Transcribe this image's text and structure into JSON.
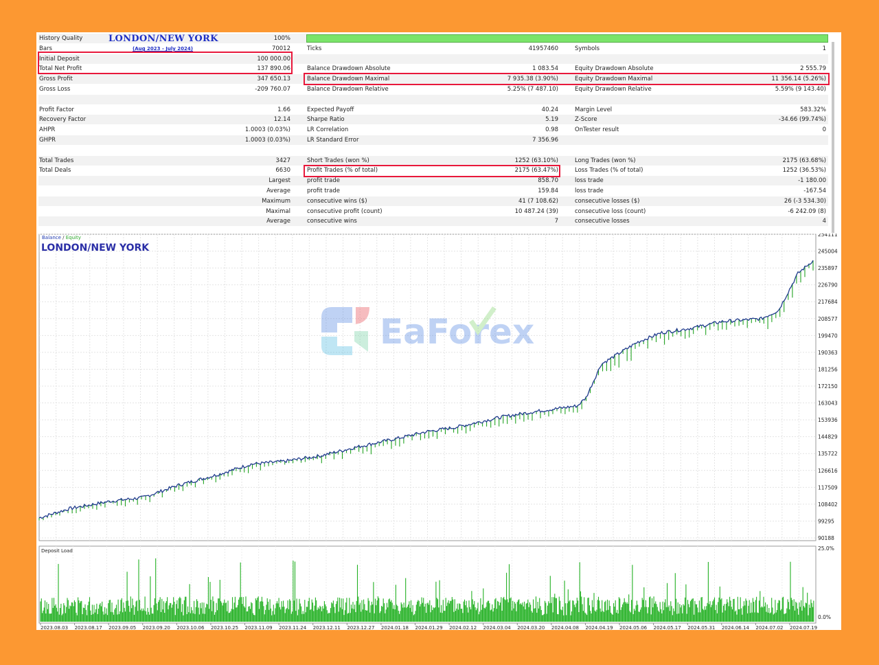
{
  "report": {
    "title": "LONDON/NEW YORK",
    "subtitle": "(Aug 2023 - July 2024)",
    "rows": [
      {
        "alt": true,
        "c1l": "History Quality",
        "c1v": "100%",
        "c2l": "",
        "c2v": "",
        "c3l": "",
        "c3v": ""
      },
      {
        "alt": false,
        "c1l": "Bars",
        "c1v": "70012",
        "c2l": "Ticks",
        "c2v": "41957460",
        "c3l": "Symbols",
        "c3v": "1"
      },
      {
        "alt": true,
        "c1l": "Initial Deposit",
        "c1v": "100 000.00",
        "c2l": "",
        "c2v": "",
        "c3l": "",
        "c3v": ""
      },
      {
        "alt": false,
        "c1l": "Total Net Profit",
        "c1v": "137 890.06",
        "c2l": "Balance Drawdown Absolute",
        "c2v": "1 083.54",
        "c3l": "Equity Drawdown Absolute",
        "c3v": "2 555.79"
      },
      {
        "alt": true,
        "c1l": "Gross Profit",
        "c1v": "347 650.13",
        "c2l": "Balance Drawdown Maximal",
        "c2v": "7 935.38 (3.90%)",
        "c3l": "Equity Drawdown Maximal",
        "c3v": "11 356.14 (5.26%)"
      },
      {
        "alt": false,
        "c1l": "Gross Loss",
        "c1v": "-209 760.07",
        "c2l": "Balance Drawdown Relative",
        "c2v": "5.25% (7 487.10)",
        "c3l": "Equity Drawdown Relative",
        "c3v": "5.59% (9 143.40)"
      },
      {
        "alt": true,
        "c1l": "",
        "c1v": "",
        "c2l": "",
        "c2v": "",
        "c3l": "",
        "c3v": ""
      },
      {
        "alt": false,
        "c1l": "Profit Factor",
        "c1v": "1.66",
        "c2l": "Expected Payoff",
        "c2v": "40.24",
        "c3l": "Margin Level",
        "c3v": "583.32%"
      },
      {
        "alt": true,
        "c1l": "Recovery Factor",
        "c1v": "12.14",
        "c2l": "Sharpe Ratio",
        "c2v": "5.19",
        "c3l": "Z-Score",
        "c3v": "-34.66 (99.74%)"
      },
      {
        "alt": false,
        "c1l": "AHPR",
        "c1v": "1.0003 (0.03%)",
        "c2l": "LR Correlation",
        "c2v": "0.98",
        "c3l": "OnTester result",
        "c3v": "0"
      },
      {
        "alt": true,
        "c1l": "GHPR",
        "c1v": "1.0003 (0.03%)",
        "c2l": "LR Standard Error",
        "c2v": "7 356.96",
        "c3l": "",
        "c3v": ""
      },
      {
        "alt": false,
        "c1l": "",
        "c1v": "",
        "c2l": "",
        "c2v": "",
        "c3l": "",
        "c3v": ""
      },
      {
        "alt": true,
        "c1l": "Total Trades",
        "c1v": "3427",
        "c2l": "Short Trades (won %)",
        "c2v": "1252 (63.10%)",
        "c3l": "Long Trades (won %)",
        "c3v": "2175 (63.68%)"
      },
      {
        "alt": false,
        "c1l": "Total Deals",
        "c1v": "6630",
        "c2l": "Profit Trades (% of total)",
        "c2v": "2175 (63.47%)",
        "c3l": "Loss Trades (% of total)",
        "c3v": "1252 (36.53%)"
      },
      {
        "alt": true,
        "c1l": "",
        "c1v": "Largest",
        "c2l": "profit trade",
        "c2v": "858.70",
        "c3l": "loss trade",
        "c3v": "-1 180.00"
      },
      {
        "alt": false,
        "c1l": "",
        "c1v": "Average",
        "c2l": "profit trade",
        "c2v": "159.84",
        "c3l": "loss trade",
        "c3v": "-167.54"
      },
      {
        "alt": true,
        "c1l": "",
        "c1v": "Maximum",
        "c2l": "consecutive wins ($)",
        "c2v": "41 (7 108.62)",
        "c3l": "consecutive losses ($)",
        "c3v": "26 (-3 534.30)"
      },
      {
        "alt": false,
        "c1l": "",
        "c1v": "Maximal",
        "c2l": "consecutive profit (count)",
        "c2v": "10 487.24 (39)",
        "c3l": "consecutive loss (count)",
        "c3v": "-6 242.09 (8)"
      },
      {
        "alt": true,
        "c1l": "",
        "c1v": "Average",
        "c2l": "consecutive wins",
        "c2v": "7",
        "c3l": "consecutive losses",
        "c3v": "4"
      }
    ]
  },
  "colors": {
    "background": "#fc9832",
    "highlight": "#e8173a",
    "balance": "#1f3a8c",
    "equity": "#1fa81f",
    "deposit_load": "#22b022",
    "title_blue": "#2b2fa7"
  },
  "chart_data": [
    {
      "type": "line",
      "title": "LONDON/NEW YORK",
      "legend": [
        "Balance",
        "Equity"
      ],
      "legend_separator": "/",
      "y_ticks": [
        "254111",
        "245004",
        "235897",
        "226790",
        "217684",
        "208577",
        "199470",
        "190363",
        "181256",
        "172150",
        "163043",
        "153936",
        "144829",
        "135722",
        "126616",
        "117509",
        "108402",
        "99295",
        "90188"
      ],
      "ylim": [
        90188,
        254111
      ],
      "x_start": "2023.08.03",
      "x_end": "2024.07.26",
      "series": [
        {
          "name": "Balance",
          "x": [
            "2023.08.03",
            "2023.08.17",
            "2023.09.05",
            "2023.09.20",
            "2023.10.06",
            "2023.10.25",
            "2023.11.09",
            "2023.11.24",
            "2023.12.11",
            "2023.12.27",
            "2024.01.18",
            "2024.01.29",
            "2024.02.12",
            "2024.03.04",
            "2024.03.20",
            "2024.04.08",
            "2024.04.12",
            "2024.04.19",
            "2024.05.06",
            "2024.05.17",
            "2024.05.31",
            "2024.06.14",
            "2024.07.02",
            "2024.07.10",
            "2024.07.19",
            "2024.07.26"
          ],
          "values": [
            101000,
            106000,
            110000,
            112000,
            118500,
            124500,
            130000,
            131500,
            134500,
            139000,
            144500,
            147500,
            150000,
            155500,
            158500,
            161500,
            166000,
            184000,
            196000,
            201000,
            203500,
            207000,
            208500,
            213000,
            233000,
            240000
          ]
        },
        {
          "name": "Equity",
          "dip_values": [
            -1500,
            -2500,
            -3000,
            -2500,
            -3000,
            -3500,
            -3000,
            -2500,
            -3500,
            -4000,
            -3000,
            -3500,
            -4000,
            -4500,
            -3000,
            -5000,
            -4000,
            -6000,
            -4500,
            -5000,
            -4500,
            -5000,
            -5500,
            -6000,
            -5000,
            -5500
          ]
        }
      ]
    },
    {
      "type": "bar",
      "title": "Deposit Load",
      "y_ticks": [
        "25.0%",
        "0.0%"
      ],
      "ylim": [
        0,
        25
      ],
      "x_ticks": [
        "2023.08.03",
        "2023.08.17",
        "2023.09.05",
        "2023.09.20",
        "2023.10.06",
        "2023.10.25",
        "2023.11.09",
        "2023.11.24",
        "2023.12.11",
        "2023.12.27",
        "2024.01.18",
        "2024.01.29",
        "2024.02.12",
        "2024.03.04",
        "2024.03.20",
        "2024.04.08",
        "2024.04.19",
        "2024.05.06",
        "2024.05.17",
        "2024.05.31",
        "2024.06.14",
        "2024.07.02",
        "2024.07.19"
      ],
      "typical_load_pct": 7,
      "peak_load_pct": 21
    }
  ],
  "watermark": {
    "text": "EaForex"
  }
}
